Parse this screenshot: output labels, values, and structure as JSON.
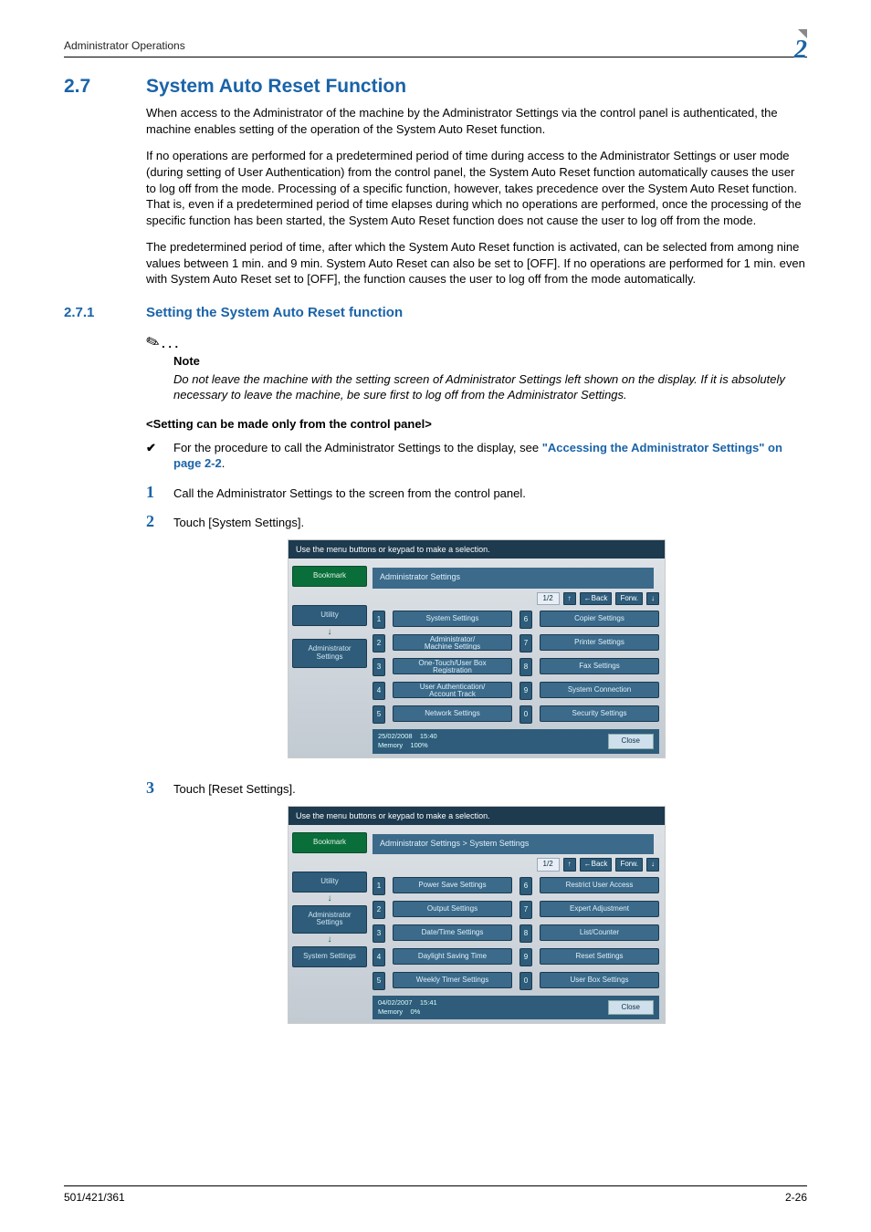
{
  "header": {
    "running_title": "Administrator Operations",
    "chapter_badge": "2"
  },
  "section": {
    "number": "2.7",
    "title": "System Auto Reset Function",
    "paras": [
      "When access to the Administrator of the machine by the Administrator Settings via the control panel is authenticated, the machine enables setting of the operation of the System Auto Reset function.",
      "If no operations are performed for a predetermined period of time during access to the Administrator Settings or user mode (during setting of User Authentication) from the control panel, the System Auto Reset function automatically causes the user to log off from the mode. Processing of a specific function, however, takes precedence over the System Auto Reset function. That is, even if a predetermined period of time elapses during which no operations are performed, once the processing of the specific function has been started, the System Auto Reset function does not cause the user to log off from the mode.",
      "The predetermined period of time, after which the System Auto Reset function is activated, can be selected from among nine values between 1 min. and 9 min. System Auto Reset can also be set to [OFF]. If no operations are performed for 1 min. even with System Auto Reset set to [OFF], the function causes the user to log off from the mode automatically."
    ]
  },
  "subsection": {
    "number": "2.7.1",
    "title": "Setting the System Auto Reset function",
    "note": {
      "label": "Note",
      "text": "Do not leave the machine with the setting screen of Administrator Settings left shown on the display. If it is absolutely necessary to leave the machine, be sure first to log off from the Administrator Settings."
    },
    "subhead": "<Setting can be made only from the control panel>",
    "checkmark": "✔",
    "procedure_intro_pre": "For the procedure to call the Administrator Settings to the display, see ",
    "procedure_intro_link": "\"Accessing the Administrator Settings\" on page 2-2",
    "procedure_intro_post": ".",
    "steps": [
      {
        "n": "1",
        "text": "Call the Administrator Settings to the screen from the control panel."
      },
      {
        "n": "2",
        "text": "Touch [System Settings]."
      },
      {
        "n": "3",
        "text": "Touch [Reset Settings]."
      }
    ]
  },
  "shot1": {
    "top": "Use the menu buttons or keypad to make a selection.",
    "breadcrumb": "Administrator Settings",
    "page": "1/2",
    "back": "←Back",
    "fwd": "Forw.",
    "side": {
      "bookmark": "Bookmark",
      "utility": "Utility",
      "admin": "Administrator\nSettings"
    },
    "items": [
      {
        "n": "1",
        "label": "System Settings"
      },
      {
        "n": "6",
        "label": "Copier Settings"
      },
      {
        "n": "2",
        "label": "Administrator/\nMachine Settings"
      },
      {
        "n": "7",
        "label": "Printer Settings"
      },
      {
        "n": "3",
        "label": "One-Touch/User Box\nRegistration"
      },
      {
        "n": "8",
        "label": "Fax Settings"
      },
      {
        "n": "4",
        "label": "User Authentication/\nAccount Track"
      },
      {
        "n": "9",
        "label": "System Connection"
      },
      {
        "n": "5",
        "label": "Network Settings"
      },
      {
        "n": "0",
        "label": "Security Settings"
      }
    ],
    "footer": {
      "date": "25/02/2008",
      "time": "15:40",
      "memlabel": "Memory",
      "mem": "100%",
      "close": "Close"
    }
  },
  "shot2": {
    "top": "Use the menu buttons or keypad to make a selection.",
    "breadcrumb": "Administrator Settings > System Settings",
    "page": "1/2",
    "back": "←Back",
    "fwd": "Forw.",
    "side": {
      "bookmark": "Bookmark",
      "utility": "Utility",
      "admin": "Administrator\nSettings",
      "sys": "System Settings"
    },
    "items": [
      {
        "n": "1",
        "label": "Power Save Settings"
      },
      {
        "n": "6",
        "label": "Restrict User Access"
      },
      {
        "n": "2",
        "label": "Output Settings"
      },
      {
        "n": "7",
        "label": "Expert Adjustment"
      },
      {
        "n": "3",
        "label": "Date/Time Settings"
      },
      {
        "n": "8",
        "label": "List/Counter"
      },
      {
        "n": "4",
        "label": "Daylight Saving Time"
      },
      {
        "n": "9",
        "label": "Reset Settings"
      },
      {
        "n": "5",
        "label": "Weekly Timer Settings"
      },
      {
        "n": "0",
        "label": "User Box Settings"
      }
    ],
    "footer": {
      "date": "04/02/2007",
      "time": "15:41",
      "memlabel": "Memory",
      "mem": "0%",
      "close": "Close"
    }
  },
  "footer": {
    "model": "501/421/361",
    "pageno": "2-26"
  }
}
